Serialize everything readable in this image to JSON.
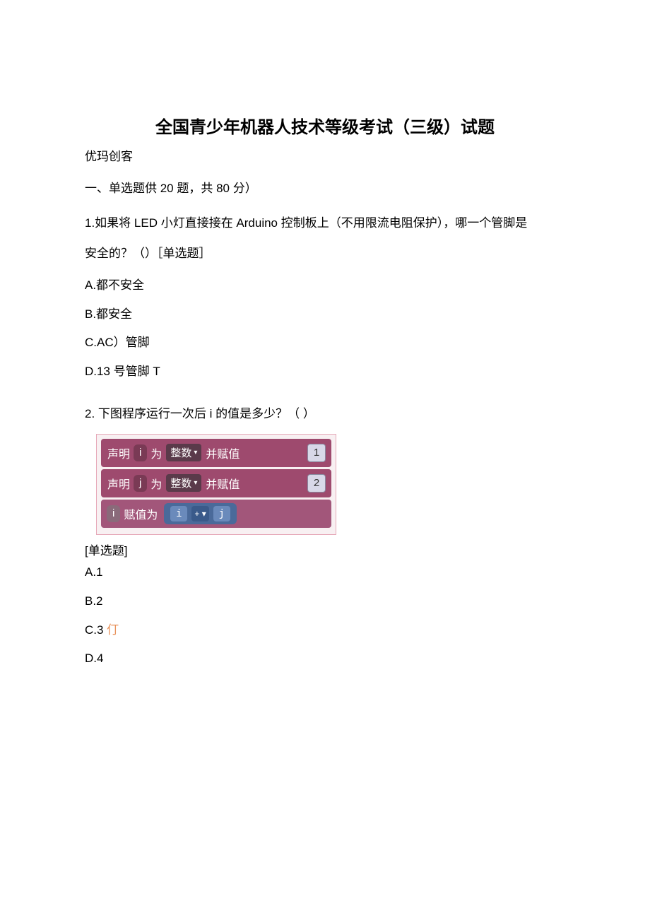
{
  "title": "全国青少年机器人技术等级考试（三级）试题",
  "subtitle": "优玛创客",
  "section": "一、单选题供 20 题，共 80 分）",
  "q1": {
    "text_line1": "1.如果将 LED 小灯直接接在 Arduino 控制板上（不用限流电阻保护），哪一个管脚是",
    "text_line2": "安全的？（）［单选题］",
    "opt_a": "A.都不安全",
    "opt_b": "B.都安全",
    "opt_c": "C.AC）管脚",
    "opt_d": "D.13 号管脚 T"
  },
  "q2": {
    "label": "2. 下图程序运行一次后 i 的值是多少？（ ）",
    "code": {
      "row1": {
        "t1": "声明",
        "var": "i",
        "t2": "为",
        "type": "整数",
        "t3": "并赋值",
        "num": "1"
      },
      "row2": {
        "t1": "声明",
        "var": "j",
        "t2": "为",
        "type": "整数",
        "t3": "并赋值",
        "num": "2"
      },
      "row3": {
        "var": "i",
        "t1": "赋值为",
        "v1": "i",
        "op": "+ ▾",
        "v2": "j"
      }
    },
    "single_q": "[单选题]",
    "opt_a": "A.1",
    "opt_b": "B.2",
    "opt_c_pre": "C.3 ",
    "opt_c_mark": "仃",
    "opt_d": "D.4"
  }
}
